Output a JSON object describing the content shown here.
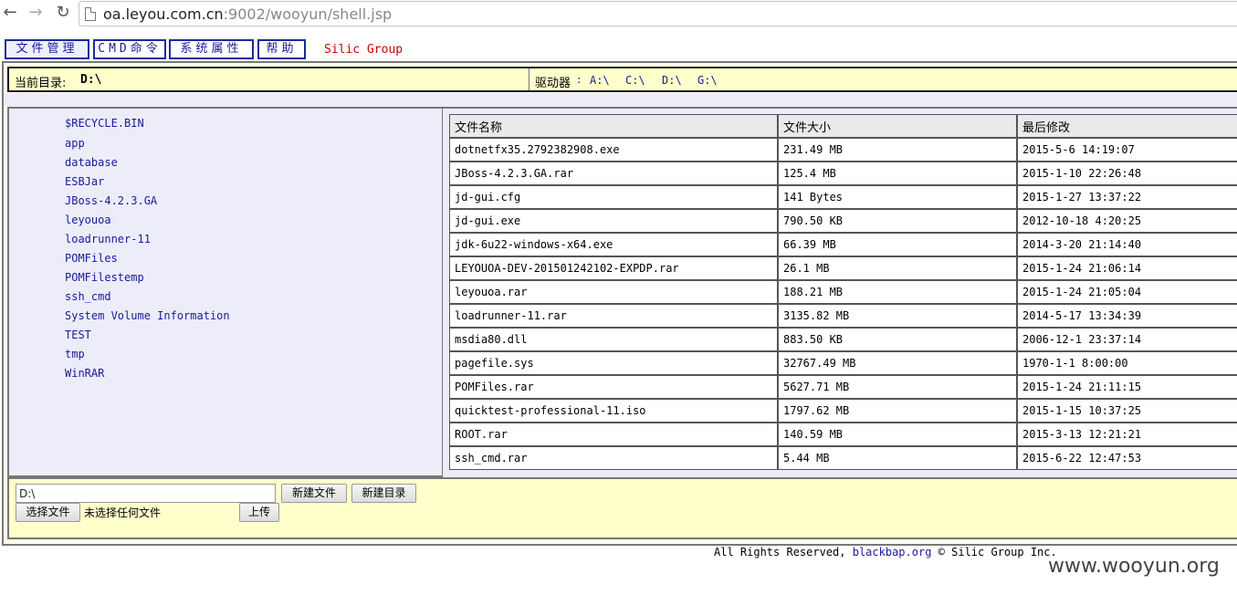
{
  "browser": {
    "url_host": "oa.leyou.com.cn",
    "url_rest": ":9002/wooyun/shell.jsp",
    "back_glyph": "←",
    "forward_glyph": "→",
    "reload_glyph": "↻"
  },
  "menu": {
    "items": [
      {
        "label": "文件管理"
      },
      {
        "label": "CMD命令"
      },
      {
        "label": "系统属性"
      },
      {
        "label": "帮助"
      }
    ],
    "brand": "Silic Group"
  },
  "dir_bar": {
    "current_label": "当前目录:",
    "current_value": "D:\\",
    "drive_label": "驱动器",
    "drive_sep": ":",
    "drives": [
      "A:\\",
      "C:\\",
      "D:\\",
      "G:\\"
    ]
  },
  "folders": [
    "$RECYCLE.BIN",
    "app",
    "database",
    "ESBJar",
    "JBoss-4.2.3.GA",
    "leyouoa",
    "loadrunner-11",
    "POMFiles",
    "POMFilestemp",
    "ssh_cmd",
    "System Volume Information",
    "TEST",
    "tmp",
    "WinRAR"
  ],
  "file_table": {
    "headers": [
      "文件名称",
      "文件大小",
      "最后修改"
    ],
    "rows": [
      [
        "dotnetfx35.2792382908.exe",
        "231.49 MB",
        "2015-5-6 14:19:07"
      ],
      [
        "JBoss-4.2.3.GA.rar",
        "125.4 MB",
        "2015-1-10 22:26:48"
      ],
      [
        "jd-gui.cfg",
        "141 Bytes",
        "2015-1-27 13:37:22"
      ],
      [
        "jd-gui.exe",
        "790.50 KB",
        "2012-10-18 4:20:25"
      ],
      [
        "jdk-6u22-windows-x64.exe",
        "66.39 MB",
        "2014-3-20 21:14:40"
      ],
      [
        "LEYOUOA-DEV-201501242102-EXPDP.rar",
        "26.1 MB",
        "2015-1-24 21:06:14"
      ],
      [
        "leyouoa.rar",
        "188.21 MB",
        "2015-1-24 21:05:04"
      ],
      [
        "loadrunner-11.rar",
        "3135.82 MB",
        "2014-5-17 13:34:39"
      ],
      [
        "msdia80.dll",
        "883.50 KB",
        "2006-12-1 23:37:14"
      ],
      [
        "pagefile.sys",
        "32767.49 MB",
        "1970-1-1 8:00:00"
      ],
      [
        "POMFiles.rar",
        "5627.71 MB",
        "2015-1-24 21:11:15"
      ],
      [
        "quicktest-professional-11.iso",
        "1797.62 MB",
        "2015-1-15 10:37:25"
      ],
      [
        "ROOT.rar",
        "140.59 MB",
        "2015-3-13 12:21:21"
      ],
      [
        "ssh_cmd.rar",
        "5.44 MB",
        "2015-6-22 12:47:53"
      ]
    ]
  },
  "actions": {
    "path_value": "D:\\",
    "new_file": "新建文件",
    "new_dir": "新建目录",
    "choose_file": "选择文件",
    "no_file": "未选择任何文件",
    "upload": "上传"
  },
  "footer": {
    "prefix": "All Rights Reserved,",
    "link": "blackbap.org",
    "suffix": "© Silic Group Inc."
  },
  "watermark": "www.wooyun.org"
}
